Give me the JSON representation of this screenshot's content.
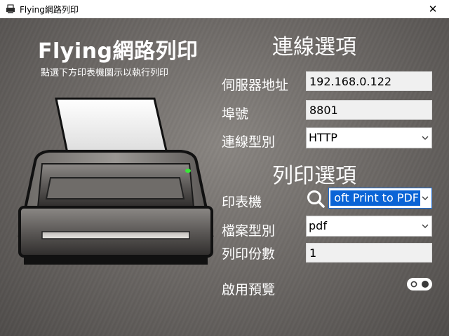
{
  "window": {
    "title": "Flying網路列印",
    "close_glyph": "✕"
  },
  "header": {
    "title": "Flying網路列印",
    "subtitle": "點選下方印表機圖示以執行列印"
  },
  "connection": {
    "section_title": "連線選項",
    "server_label": "伺服器地址",
    "server_value": "192.168.0.122",
    "port_label": "埠號",
    "port_value": "8801",
    "type_label": "連線型別",
    "type_value": "HTTP"
  },
  "print": {
    "section_title": "列印選項",
    "printer_label": "印表機",
    "printer_value": "oft Print to PDF",
    "filetype_label": "檔案型別",
    "filetype_value": "pdf",
    "copies_label": "列印份數",
    "copies_value": "1",
    "preview_label": "啟用預覽",
    "preview_enabled": false
  },
  "icons": {
    "app": "printer-app-icon",
    "close": "close-icon",
    "search": "search-icon",
    "dropdown": "chevron-down-icon",
    "printer": "printer-icon"
  },
  "colors": {
    "selection": "#0a64d6",
    "focus_border": "#1e6fd8",
    "status_led": "#39e639"
  }
}
